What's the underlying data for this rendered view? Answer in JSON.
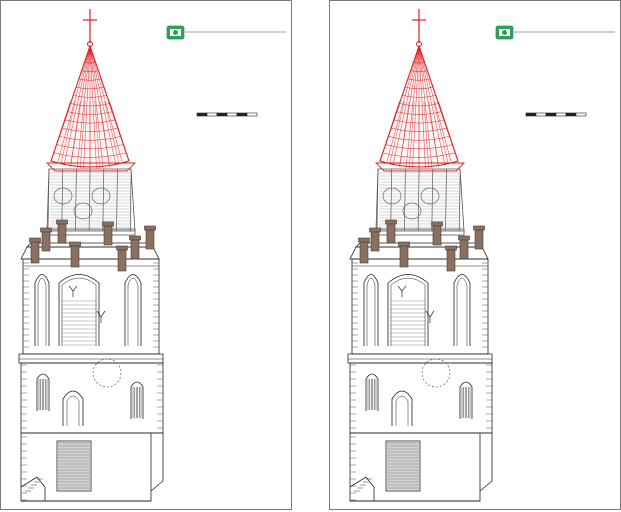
{
  "sheets": [
    {
      "id": "left",
      "variant": "with-roof-ornament"
    },
    {
      "id": "right",
      "variant": "plain-roof"
    }
  ],
  "colors": {
    "line": "#222222",
    "spire": "#e02020",
    "chimney": "#8a7060",
    "logo": "#2f9e5a",
    "frame": "#7a7a7a"
  },
  "icons": {
    "logo": "institution-logo",
    "scale": "scale-bar"
  }
}
